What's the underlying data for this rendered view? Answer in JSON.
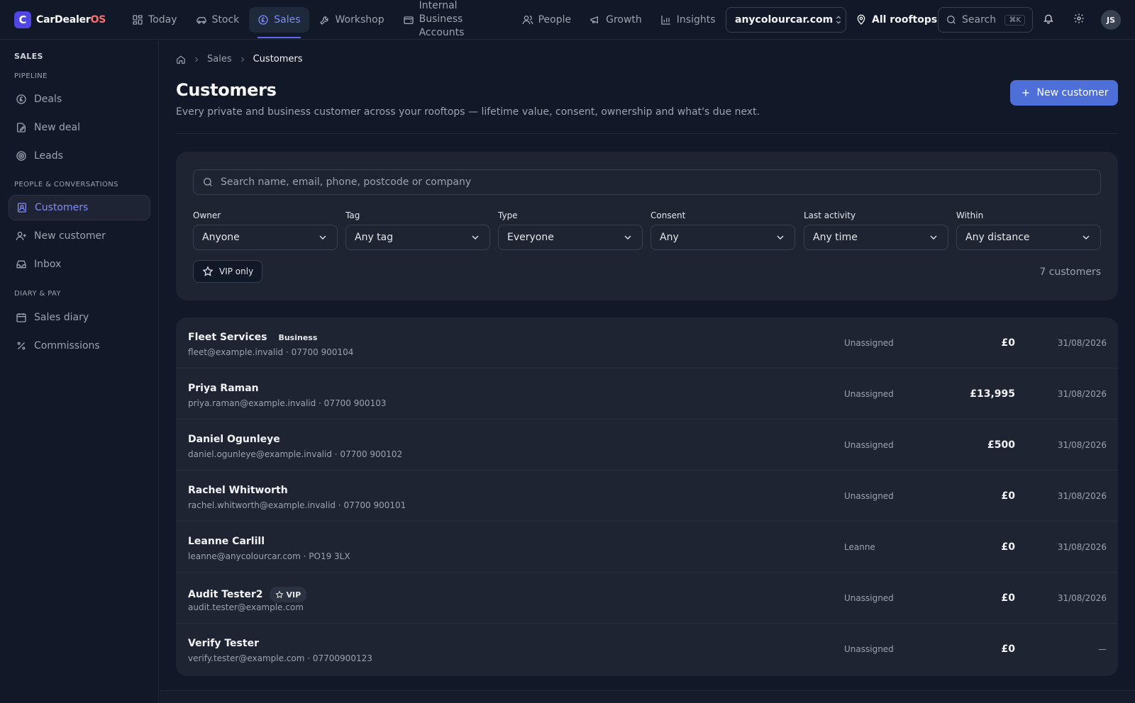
{
  "brand": {
    "name": "CarDealer",
    "suffix": "OS",
    "logo_letter": "C",
    "accent": "#4f46e5"
  },
  "topnav": [
    {
      "label": "Today",
      "icon": "dashboard-icon"
    },
    {
      "label": "Stock",
      "icon": "car-icon"
    },
    {
      "label": "Sales",
      "icon": "pound-circle-icon",
      "active": true
    },
    {
      "label": "Workshop",
      "icon": "wrench-icon"
    },
    {
      "label": "Internal Business Accounts",
      "icon": "wallet-icon"
    },
    {
      "label": "People",
      "icon": "users-icon"
    },
    {
      "label": "Growth",
      "icon": "megaphone-icon"
    },
    {
      "label": "Insights",
      "icon": "bar-chart-icon"
    }
  ],
  "site_select": {
    "value": "anycolourcar.com"
  },
  "rooftops": {
    "label": "All rooftops"
  },
  "search": {
    "label": "Search",
    "shortcut": "⌘K"
  },
  "user": {
    "initials": "JS"
  },
  "sidebar": {
    "title": "SALES",
    "sections": [
      {
        "title": "PIPELINE",
        "items": [
          {
            "label": "Deals"
          },
          {
            "label": "New deal"
          },
          {
            "label": "Leads"
          }
        ]
      },
      {
        "title": "PEOPLE & CONVERSATIONS",
        "items": [
          {
            "label": "Customers",
            "active": true
          },
          {
            "label": "New customer"
          },
          {
            "label": "Inbox"
          }
        ]
      },
      {
        "title": "DIARY & PAY",
        "items": [
          {
            "label": "Sales diary"
          },
          {
            "label": "Commissions"
          }
        ]
      }
    ]
  },
  "breadcrumb": {
    "level1": "Sales",
    "current": "Customers"
  },
  "page": {
    "title": "Customers",
    "subtitle": "Every private and business customer across your rooftops — lifetime value, consent, ownership and what's due next.",
    "new_button": "New customer"
  },
  "filters": {
    "search_placeholder": "Search name, email, phone, postcode or company",
    "owner": {
      "label": "Owner",
      "value": "Anyone"
    },
    "tag": {
      "label": "Tag",
      "value": "Any tag"
    },
    "type": {
      "label": "Type",
      "value": "Everyone"
    },
    "consent": {
      "label": "Consent",
      "value": "Any"
    },
    "last_activity": {
      "label": "Last activity",
      "value": "Any time"
    },
    "within": {
      "label": "Within",
      "value": "Any distance"
    },
    "vip_only": "VIP only",
    "count": "7 customers"
  },
  "customers": [
    {
      "name": "Fleet Services",
      "tag": "Business",
      "meta": "fleet@example.invalid · 07700 900104",
      "owner": "Unassigned",
      "value": "£0",
      "date": "31/08/2026"
    },
    {
      "name": "Priya Raman",
      "meta": "priya.raman@example.invalid · 07700 900103",
      "owner": "Unassigned",
      "value": "£13,995",
      "date": "31/08/2026"
    },
    {
      "name": "Daniel Ogunleye",
      "meta": "daniel.ogunleye@example.invalid · 07700 900102",
      "owner": "Unassigned",
      "value": "£500",
      "date": "31/08/2026"
    },
    {
      "name": "Rachel Whitworth",
      "meta": "rachel.whitworth@example.invalid · 07700 900101",
      "owner": "Unassigned",
      "value": "£0",
      "date": "31/08/2026"
    },
    {
      "name": "Leanne Carlill",
      "meta": "leanne@anycolourcar.com · PO19 3LX",
      "owner": "Leanne",
      "value": "£0",
      "date": "31/08/2026"
    },
    {
      "name": "Audit Tester2",
      "vip": "VIP",
      "meta": "audit.tester@example.com",
      "owner": "Unassigned",
      "value": "£0",
      "date": "31/08/2026"
    },
    {
      "name": "Verify Tester",
      "meta": "verify.tester@example.com · 07700900123",
      "owner": "Unassigned",
      "value": "£0",
      "date": "—"
    }
  ]
}
